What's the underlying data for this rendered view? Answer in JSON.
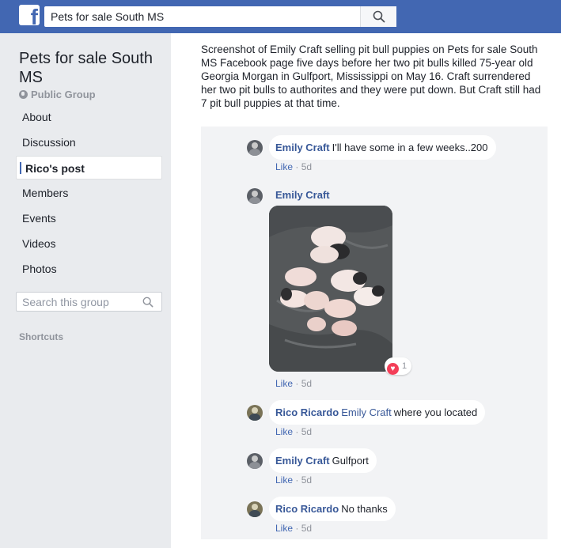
{
  "topbar": {
    "logo": "f",
    "search_value": "Pets for sale South MS",
    "search_icon": "search-icon",
    "bg_color": "#4267b2"
  },
  "sidebar": {
    "group_name": "Pets for sale South MS",
    "privacy": "Public Group",
    "privacy_icon": "globe-icon",
    "items": [
      {
        "label": "About"
      },
      {
        "label": "Discussion"
      },
      {
        "label": "Rico's post"
      },
      {
        "label": "Members"
      },
      {
        "label": "Events"
      },
      {
        "label": "Videos"
      },
      {
        "label": "Photos"
      }
    ],
    "active_item": "Rico's post",
    "search_placeholder": "Search this group",
    "shortcuts_label": "Shortcuts"
  },
  "main": {
    "caption": "Screenshot of Emily Craft selling pit bull puppies on Pets for sale South MS Facebook page five days before her two pit bulls killed 75-year old Georgia Morgan in Gulfport, Mississippi on May 16. Craft surrendered her two pit bulls to authorites and they were put down. But Craft still had 7 pit bull puppies at that time.",
    "comments": [
      {
        "author": "Emily Craft",
        "text": "I'll have some in a few weeks..200",
        "like": "Like",
        "time": "5d"
      },
      {
        "author": "Emily Craft",
        "like": "Like",
        "time": "5d",
        "reaction_count": "1",
        "reaction_icon": "heart-icon"
      },
      {
        "author": "Rico Ricardo",
        "mention": "Emily Craft",
        "text": "where you located",
        "like": "Like",
        "time": "5d"
      },
      {
        "author": "Emily Craft",
        "text": "Gulfport",
        "like": "Like",
        "time": "5d"
      },
      {
        "author": "Rico Ricardo",
        "text": "No thanks",
        "like": "Like",
        "time": "5d"
      }
    ],
    "meta_separator": " · "
  }
}
